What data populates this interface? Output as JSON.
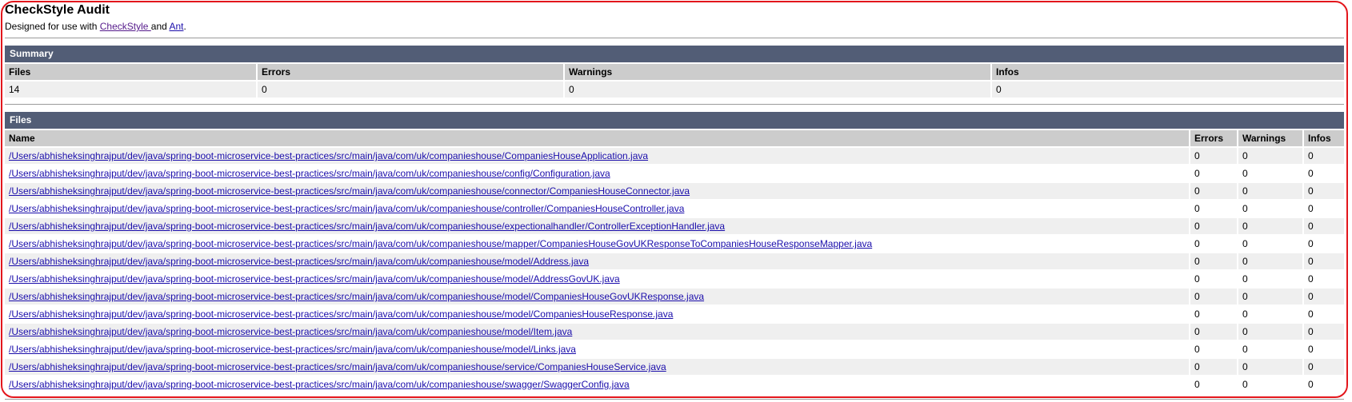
{
  "title": "CheckStyle Audit",
  "subtitle": {
    "prefix": "Designed for use with ",
    "link1": "CheckStyle ",
    "middle": "and ",
    "link2": "Ant",
    "suffix": "."
  },
  "summary": {
    "header": "Summary",
    "columns": [
      "Files",
      "Errors",
      "Warnings",
      "Infos"
    ],
    "values": [
      "14",
      "0",
      "0",
      "0"
    ]
  },
  "files": {
    "header": "Files",
    "columns": [
      "Name",
      "Errors",
      "Warnings",
      "Infos"
    ],
    "rows": [
      {
        "name": "/Users/abhisheksinghrajput/dev/java/spring-boot-microservice-best-practices/src/main/java/com/uk/companieshouse/CompaniesHouseApplication.java",
        "errors": "0",
        "warnings": "0",
        "infos": "0"
      },
      {
        "name": "/Users/abhisheksinghrajput/dev/java/spring-boot-microservice-best-practices/src/main/java/com/uk/companieshouse/config/Configuration.java",
        "errors": "0",
        "warnings": "0",
        "infos": "0"
      },
      {
        "name": "/Users/abhisheksinghrajput/dev/java/spring-boot-microservice-best-practices/src/main/java/com/uk/companieshouse/connector/CompaniesHouseConnector.java",
        "errors": "0",
        "warnings": "0",
        "infos": "0"
      },
      {
        "name": "/Users/abhisheksinghrajput/dev/java/spring-boot-microservice-best-practices/src/main/java/com/uk/companieshouse/controller/CompaniesHouseController.java",
        "errors": "0",
        "warnings": "0",
        "infos": "0"
      },
      {
        "name": "/Users/abhisheksinghrajput/dev/java/spring-boot-microservice-best-practices/src/main/java/com/uk/companieshouse/expectionalhandler/ControllerExceptionHandler.java",
        "errors": "0",
        "warnings": "0",
        "infos": "0"
      },
      {
        "name": "/Users/abhisheksinghrajput/dev/java/spring-boot-microservice-best-practices/src/main/java/com/uk/companieshouse/mapper/CompaniesHouseGovUKResponseToCompaniesHouseResponseMapper.java",
        "errors": "0",
        "warnings": "0",
        "infos": "0"
      },
      {
        "name": "/Users/abhisheksinghrajput/dev/java/spring-boot-microservice-best-practices/src/main/java/com/uk/companieshouse/model/Address.java",
        "errors": "0",
        "warnings": "0",
        "infos": "0"
      },
      {
        "name": "/Users/abhisheksinghrajput/dev/java/spring-boot-microservice-best-practices/src/main/java/com/uk/companieshouse/model/AddressGovUK.java",
        "errors": "0",
        "warnings": "0",
        "infos": "0"
      },
      {
        "name": "/Users/abhisheksinghrajput/dev/java/spring-boot-microservice-best-practices/src/main/java/com/uk/companieshouse/model/CompaniesHouseGovUKResponse.java",
        "errors": "0",
        "warnings": "0",
        "infos": "0"
      },
      {
        "name": "/Users/abhisheksinghrajput/dev/java/spring-boot-microservice-best-practices/src/main/java/com/uk/companieshouse/model/CompaniesHouseResponse.java",
        "errors": "0",
        "warnings": "0",
        "infos": "0"
      },
      {
        "name": "/Users/abhisheksinghrajput/dev/java/spring-boot-microservice-best-practices/src/main/java/com/uk/companieshouse/model/Item.java",
        "errors": "0",
        "warnings": "0",
        "infos": "0"
      },
      {
        "name": "/Users/abhisheksinghrajput/dev/java/spring-boot-microservice-best-practices/src/main/java/com/uk/companieshouse/model/Links.java",
        "errors": "0",
        "warnings": "0",
        "infos": "0"
      },
      {
        "name": "/Users/abhisheksinghrajput/dev/java/spring-boot-microservice-best-practices/src/main/java/com/uk/companieshouse/service/CompaniesHouseService.java",
        "errors": "0",
        "warnings": "0",
        "infos": "0"
      },
      {
        "name": "/Users/abhisheksinghrajput/dev/java/spring-boot-microservice-best-practices/src/main/java/com/uk/companieshouse/swagger/SwaggerConfig.java",
        "errors": "0",
        "warnings": "0",
        "infos": "0"
      }
    ]
  },
  "colors": {
    "section_header_bg": "#525d76",
    "column_header_bg": "#cccccc",
    "row_alt_bg": "#efefef",
    "link": "#1a0dab",
    "link_visited": "#551a8b",
    "frame_border": "#e3161c"
  }
}
